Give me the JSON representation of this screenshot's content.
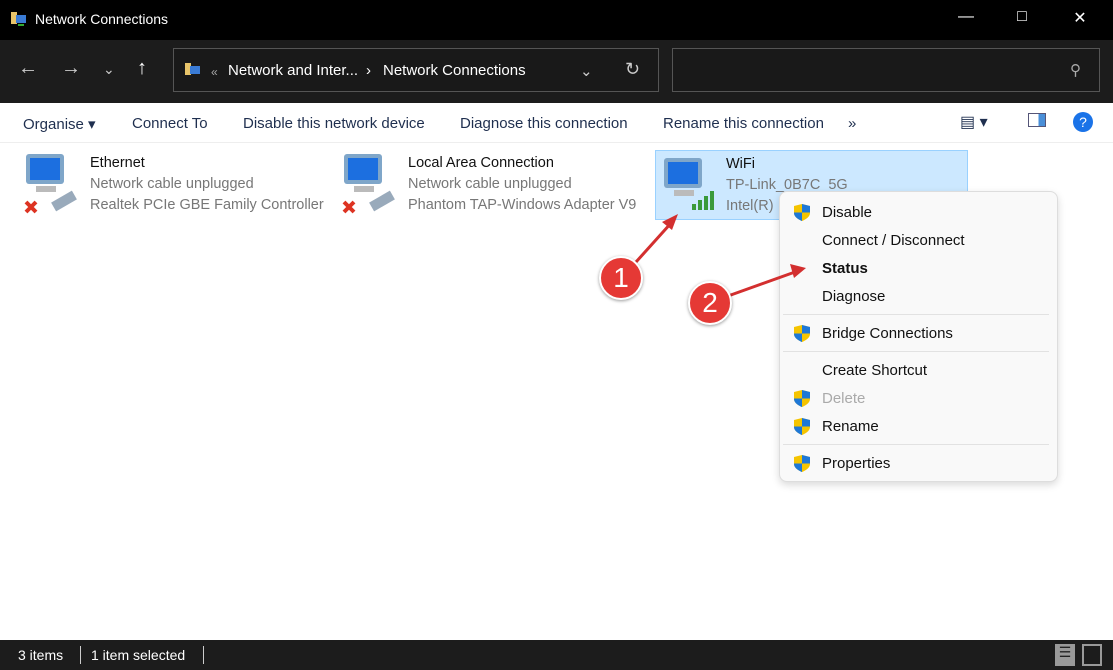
{
  "window": {
    "title": "Network Connections"
  },
  "address": {
    "chev": "«",
    "crumb1": "Network and Inter...",
    "sep": "›",
    "crumb2": "Network Connections"
  },
  "toolbar": {
    "organise": "Organise ▾",
    "connect_to": "Connect To",
    "disable": "Disable this network device",
    "diagnose": "Diagnose this connection",
    "rename": "Rename this connection",
    "more": "»"
  },
  "items": [
    {
      "name": "Ethernet",
      "status": "Network cable unplugged",
      "device": "Realtek PCIe GBE Family Controller"
    },
    {
      "name": "Local Area Connection",
      "status": "Network cable unplugged",
      "device": "Phantom TAP-Windows Adapter V9"
    },
    {
      "name": "WiFi",
      "status": "TP-Link_0B7C_5G",
      "device": "Intel(R)"
    }
  ],
  "context_menu": [
    "Disable",
    "Connect / Disconnect",
    "Status",
    "Diagnose",
    "Bridge Connections",
    "Create Shortcut",
    "Delete",
    "Rename",
    "Properties"
  ],
  "annotations": [
    "1",
    "2"
  ],
  "statusbar": {
    "count": "3 items",
    "selected": "1 item selected"
  }
}
